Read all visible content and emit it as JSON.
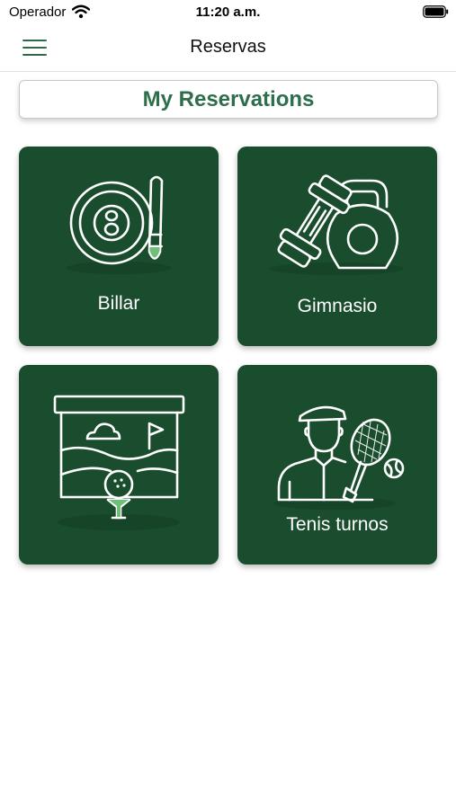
{
  "status_bar": {
    "carrier": "Operador",
    "time": "11:20 a.m."
  },
  "nav": {
    "title": "Reservas",
    "menu_icon": "hamburger-menu-icon"
  },
  "my_reservations_label": "My Reservations",
  "tiles": [
    {
      "label": "Billar",
      "icon": "billiard-ball-icon"
    },
    {
      "label": "Gimnasio",
      "icon": "dumbbell-kettlebell-icon"
    },
    {
      "label": "",
      "icon": "golf-course-icon"
    },
    {
      "label": "Tenis turnos",
      "icon": "tennis-player-icon"
    }
  ],
  "colors": {
    "tile_bg": "#1a4d2e",
    "accent": "#2e6e4a",
    "icon_highlight": "#6fbf7a"
  }
}
